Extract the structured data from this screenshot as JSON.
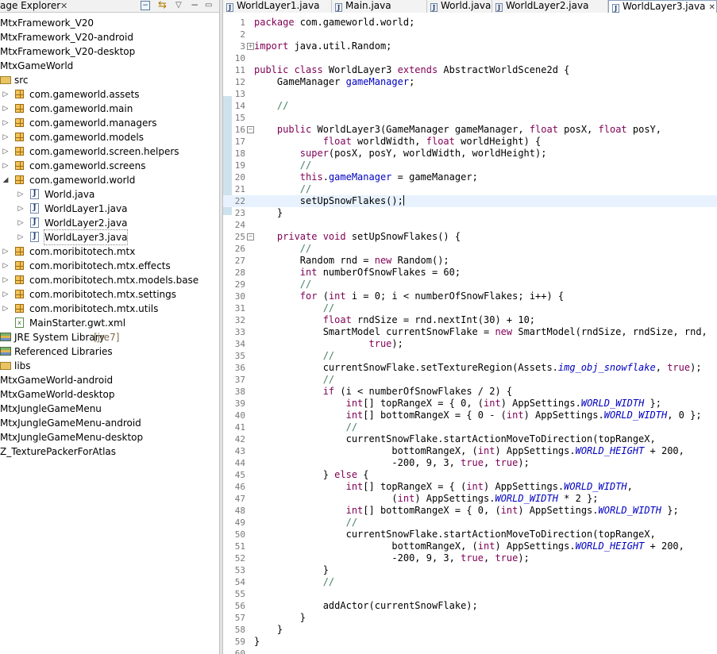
{
  "package_explorer": {
    "title": "age Explorer",
    "tree": [
      {
        "label": "MtxFramework_V20",
        "icon": "project-icon",
        "indent": 0
      },
      {
        "label": "MtxFramework_V20-android",
        "icon": "project-icon",
        "indent": 0
      },
      {
        "label": "MtxFramework_V20-desktop",
        "icon": "project-icon",
        "indent": 0
      },
      {
        "label": "MtxGameWorld",
        "icon": "project-icon",
        "indent": 0
      },
      {
        "label": "src",
        "icon": "source-folder-icon",
        "indent": 0
      },
      {
        "label": "com.gameworld.assets",
        "icon": "package-icon",
        "indent": 1,
        "arrow": "▷"
      },
      {
        "label": "com.gameworld.main",
        "icon": "package-icon",
        "indent": 1,
        "arrow": "▷"
      },
      {
        "label": "com.gameworld.managers",
        "icon": "package-icon",
        "indent": 1,
        "arrow": "▷"
      },
      {
        "label": "com.gameworld.models",
        "icon": "package-icon",
        "indent": 1,
        "arrow": "▷"
      },
      {
        "label": "com.gameworld.screen.helpers",
        "icon": "package-icon",
        "indent": 1,
        "arrow": "▷"
      },
      {
        "label": "com.gameworld.screens",
        "icon": "package-icon",
        "indent": 1,
        "arrow": "▷"
      },
      {
        "label": "com.gameworld.world",
        "icon": "package-icon",
        "indent": 1,
        "arrow": "◢"
      },
      {
        "label": "World.java",
        "icon": "java-file-icon",
        "indent": 2,
        "arrow": "▷"
      },
      {
        "label": "WorldLayer1.java",
        "icon": "java-file-icon",
        "indent": 2,
        "arrow": "▷"
      },
      {
        "label": "WorldLayer2.java",
        "icon": "java-file-icon",
        "indent": 2,
        "arrow": "▷"
      },
      {
        "label": "WorldLayer3.java",
        "icon": "java-file-icon",
        "indent": 2,
        "arrow": "▷",
        "selected": true
      },
      {
        "label": "com.moribitotech.mtx",
        "icon": "package-icon",
        "indent": 1,
        "arrow": "▷"
      },
      {
        "label": "com.moribitotech.mtx.effects",
        "icon": "package-icon",
        "indent": 1,
        "arrow": "▷"
      },
      {
        "label": "com.moribitotech.mtx.models.base",
        "icon": "package-icon",
        "indent": 1,
        "arrow": "▷"
      },
      {
        "label": "com.moribitotech.mtx.settings",
        "icon": "package-icon",
        "indent": 1,
        "arrow": "▷"
      },
      {
        "label": "com.moribitotech.mtx.utils",
        "icon": "package-icon",
        "indent": 1,
        "arrow": "▷"
      },
      {
        "label": "MainStarter.gwt.xml",
        "icon": "xml-file-icon",
        "indent": 1
      },
      {
        "label": "JRE System Library",
        "tag": "[jre7]",
        "icon": "library-icon",
        "indent": 0
      },
      {
        "label": "Referenced Libraries",
        "icon": "library-icon",
        "indent": 0
      },
      {
        "label": "libs",
        "icon": "folder-icon",
        "indent": 0
      },
      {
        "label": "MtxGameWorld-android",
        "icon": "project-icon",
        "indent": 0
      },
      {
        "label": "MtxGameWorld-desktop",
        "icon": "project-icon",
        "indent": 0
      },
      {
        "label": "MtxJungleGameMenu",
        "icon": "project-icon",
        "indent": 0
      },
      {
        "label": "MtxJungleGameMenu-android",
        "icon": "project-icon",
        "indent": 0
      },
      {
        "label": "MtxJungleGameMenu-desktop",
        "icon": "project-icon",
        "indent": 0
      },
      {
        "label": "Z_TexturePackerForAtlas",
        "icon": "project-icon",
        "indent": 0
      }
    ]
  },
  "editor_tabs": [
    {
      "label": "WorldLayer1.java",
      "active": false
    },
    {
      "label": "Main.java",
      "active": false
    },
    {
      "label": "World.java",
      "active": false
    },
    {
      "label": "WorldLayer2.java",
      "active": false
    },
    {
      "label": "WorldLayer3.java",
      "active": true
    }
  ],
  "editor": {
    "current_line": 22,
    "lines": [
      {
        "n": "1",
        "html": "<span class=\"kw\">package</span> com.gameworld.world;"
      },
      {
        "n": "2",
        "html": ""
      },
      {
        "n": "3",
        "fold": "+",
        "html": "<span class=\"kw\">import</span> java.util.Random;"
      },
      {
        "n": "10",
        "html": ""
      },
      {
        "n": "11",
        "html": "<span class=\"kw\">public class</span> WorldLayer3 <span class=\"kw\">extends</span> AbstractWorldScene2d {"
      },
      {
        "n": "12",
        "html": "    GameManager <span class=\"fld\">gameManager</span>;"
      },
      {
        "n": "13",
        "html": ""
      },
      {
        "n": "14",
        "html": "    <span class=\"cmt\">//</span>"
      },
      {
        "n": "15",
        "html": ""
      },
      {
        "n": "16",
        "fold": "−",
        "html": "    <span class=\"kw\">public</span> WorldLayer3(GameManager gameManager, <span class=\"kw\">float</span> posX, <span class=\"kw\">float</span> posY,"
      },
      {
        "n": "17",
        "html": "            <span class=\"kw\">float</span> worldWidth, <span class=\"kw\">float</span> worldHeight) {"
      },
      {
        "n": "18",
        "html": "        <span class=\"kw\">super</span>(posX, posY, worldWidth, worldHeight);"
      },
      {
        "n": "19",
        "html": "        <span class=\"cmt\">//</span>"
      },
      {
        "n": "20",
        "html": "        <span class=\"kw\">this</span>.<span class=\"fld\">gameManager</span> = gameManager;"
      },
      {
        "n": "21",
        "html": "        <span class=\"cmt\">//</span>"
      },
      {
        "n": "22",
        "html": "        setUpSnowFlakes();<span class=\"caret\"></span>"
      },
      {
        "n": "23",
        "html": "    }"
      },
      {
        "n": "24",
        "html": ""
      },
      {
        "n": "25",
        "fold": "−",
        "html": "    <span class=\"kw\">private void</span> setUpSnowFlakes() {"
      },
      {
        "n": "26",
        "html": "        <span class=\"cmt\">//</span>"
      },
      {
        "n": "27",
        "html": "        Random rnd = <span class=\"kw\">new</span> Random();"
      },
      {
        "n": "28",
        "html": "        <span class=\"kw\">int</span> numberOfSnowFlakes = 60;"
      },
      {
        "n": "29",
        "html": "        <span class=\"cmt\">//</span>"
      },
      {
        "n": "30",
        "html": "        <span class=\"kw\">for</span> (<span class=\"kw\">int</span> i = 0; i &lt; numberOfSnowFlakes; i++) {"
      },
      {
        "n": "31",
        "html": "            <span class=\"cmt\">//</span>"
      },
      {
        "n": "32",
        "html": "            <span class=\"kw\">float</span> rndSize = rnd.nextInt(30) + 10;"
      },
      {
        "n": "33",
        "html": "            SmartModel currentSnowFlake = <span class=\"kw\">new</span> SmartModel(rndSize, rndSize, rnd,"
      },
      {
        "n": "34",
        "html": "                    <span class=\"kw\">true</span>);"
      },
      {
        "n": "35",
        "html": "            <span class=\"cmt\">//</span>"
      },
      {
        "n": "36",
        "html": "            currentSnowFlake.setTextureRegion(Assets.<span class=\"sfld\">img_obj_snowflake</span>, <span class=\"kw\">true</span>);"
      },
      {
        "n": "37",
        "html": "            <span class=\"cmt\">//</span>"
      },
      {
        "n": "38",
        "html": "            <span class=\"kw\">if</span> (i &lt; numberOfSnowFlakes / 2) {"
      },
      {
        "n": "39",
        "html": "                <span class=\"kw\">int</span>[] topRangeX = { 0, (<span class=\"kw\">int</span>) AppSettings.<span class=\"sfld\">WORLD_WIDTH</span> };"
      },
      {
        "n": "40",
        "html": "                <span class=\"kw\">int</span>[] bottomRangeX = { 0 - (<span class=\"kw\">int</span>) AppSettings.<span class=\"sfld\">WORLD_WIDTH</span>, 0 };"
      },
      {
        "n": "41",
        "html": "                <span class=\"cmt\">//</span>"
      },
      {
        "n": "42",
        "html": "                currentSnowFlake.startActionMoveToDirection(topRangeX,"
      },
      {
        "n": "43",
        "html": "                        bottomRangeX, (<span class=\"kw\">int</span>) AppSettings.<span class=\"sfld\">WORLD_HEIGHT</span> + 200,"
      },
      {
        "n": "44",
        "html": "                        -200, 9, 3, <span class=\"kw\">true</span>, <span class=\"kw\">true</span>);"
      },
      {
        "n": "45",
        "html": "            } <span class=\"kw\">else</span> {"
      },
      {
        "n": "46",
        "html": "                <span class=\"kw\">int</span>[] topRangeX = { (<span class=\"kw\">int</span>) AppSettings.<span class=\"sfld\">WORLD_WIDTH</span>,"
      },
      {
        "n": "47",
        "html": "                        (<span class=\"kw\">int</span>) AppSettings.<span class=\"sfld\">WORLD_WIDTH</span> * 2 };"
      },
      {
        "n": "48",
        "html": "                <span class=\"kw\">int</span>[] bottomRangeX = { 0, (<span class=\"kw\">int</span>) AppSettings.<span class=\"sfld\">WORLD_WIDTH</span> };"
      },
      {
        "n": "49",
        "html": "                <span class=\"cmt\">//</span>"
      },
      {
        "n": "50",
        "html": "                currentSnowFlake.startActionMoveToDirection(topRangeX,"
      },
      {
        "n": "51",
        "html": "                        bottomRangeX, (<span class=\"kw\">int</span>) AppSettings.<span class=\"sfld\">WORLD_HEIGHT</span> + 200,"
      },
      {
        "n": "52",
        "html": "                        -200, 9, 3, <span class=\"kw\">true</span>, <span class=\"kw\">true</span>);"
      },
      {
        "n": "53",
        "html": "            }"
      },
      {
        "n": "54",
        "html": "            <span class=\"cmt\">//</span>"
      },
      {
        "n": "55",
        "html": ""
      },
      {
        "n": "56",
        "html": "            addActor(currentSnowFlake);"
      },
      {
        "n": "57",
        "html": "        }"
      },
      {
        "n": "58",
        "html": "    }"
      },
      {
        "n": "59",
        "html": "}"
      },
      {
        "n": "60",
        "html": ""
      }
    ]
  }
}
